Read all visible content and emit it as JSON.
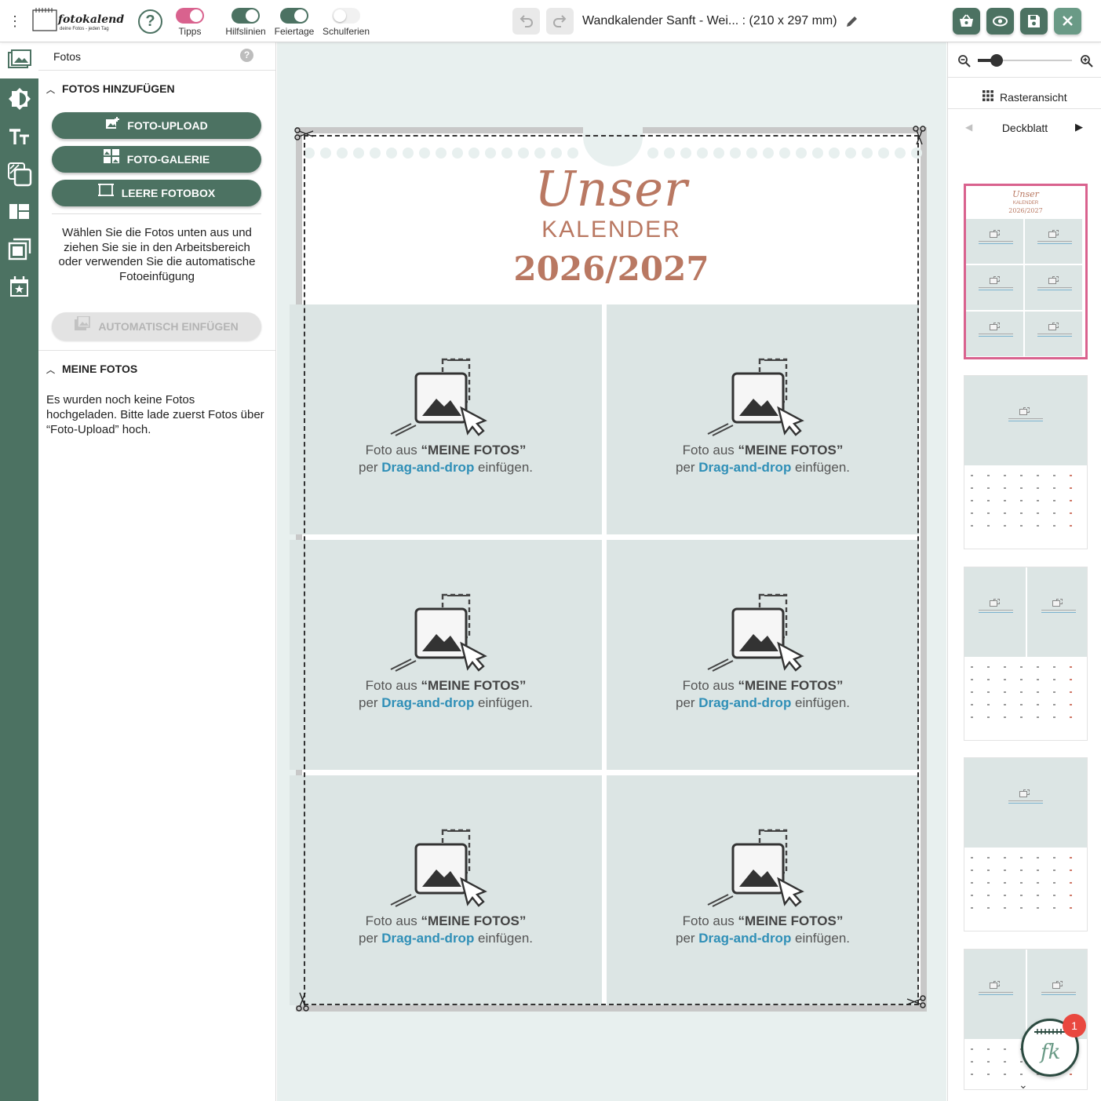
{
  "app": {
    "logo_text": "fotokalender.com",
    "logo_tagline": "deine Fotos - jeden Tag",
    "brand_color": "#4c7262",
    "accent_color": "#d9628e"
  },
  "topbar": {
    "help_label": "?",
    "toggles": [
      {
        "label": "Tipps",
        "state": "on",
        "color": "#d9628e"
      },
      {
        "label": "Hilfslinien",
        "state": "on",
        "color": "#4c7262"
      },
      {
        "label": "Feiertage",
        "state": "on",
        "color": "#4c7262"
      },
      {
        "label": "Schulferien",
        "state": "off",
        "color": "#f1f1f1"
      }
    ],
    "document_title": "Wandkalender Sanft - Wei... : (210 x 297 mm)",
    "actions": [
      "basket-icon",
      "eye-icon",
      "save-icon",
      "close-icon"
    ]
  },
  "rail": {
    "items": [
      "photos-icon",
      "background-icon",
      "text-icon",
      "layers-icon",
      "layout-icon",
      "frames-icon",
      "calendar-icon"
    ],
    "active": "photos-icon"
  },
  "panel": {
    "title": "Fotos",
    "help": "?",
    "section_add": "FOTOS HINZUFÜGEN",
    "btn_upload": "FOTO-UPLOAD",
    "btn_gallery": "FOTO-GALERIE",
    "btn_empty_box": "LEERE FOTOBOX",
    "instructions": "Wählen Sie die Fotos unten aus und ziehen Sie sie in den Arbeitsbereich oder verwenden Sie die automatische Fotoeinfügung",
    "btn_auto": "AUTOMATISCH EINFÜGEN",
    "section_my": "MEINE FOTOS",
    "no_photos": "Es wurden noch keine Fotos hochgeladen. Bitte lade zuerst Fotos über “Foto-Upload” hoch."
  },
  "canvas": {
    "title_script": "Unser",
    "title_main": "KALENDER",
    "title_year": "2026/2027",
    "title_color": "#b97862",
    "placeholder": {
      "line1_prefix": "Foto aus ",
      "line1_bold": "“MEINE FOTOS”",
      "line2_prefix": "per ",
      "line2_bold": "Drag-and-drop",
      "line2_suffix": " einfügen."
    },
    "cell_count": 6
  },
  "right_panel": {
    "zoom_level": 0.2,
    "raster_label": "Rasteransicht",
    "page_label": "Deckblatt",
    "thumb_placeholder": "Foto aus “MEINE FOTOS” per Drag-and-drop einfügen",
    "selected_thumb": 0,
    "chat_badge": "1"
  }
}
